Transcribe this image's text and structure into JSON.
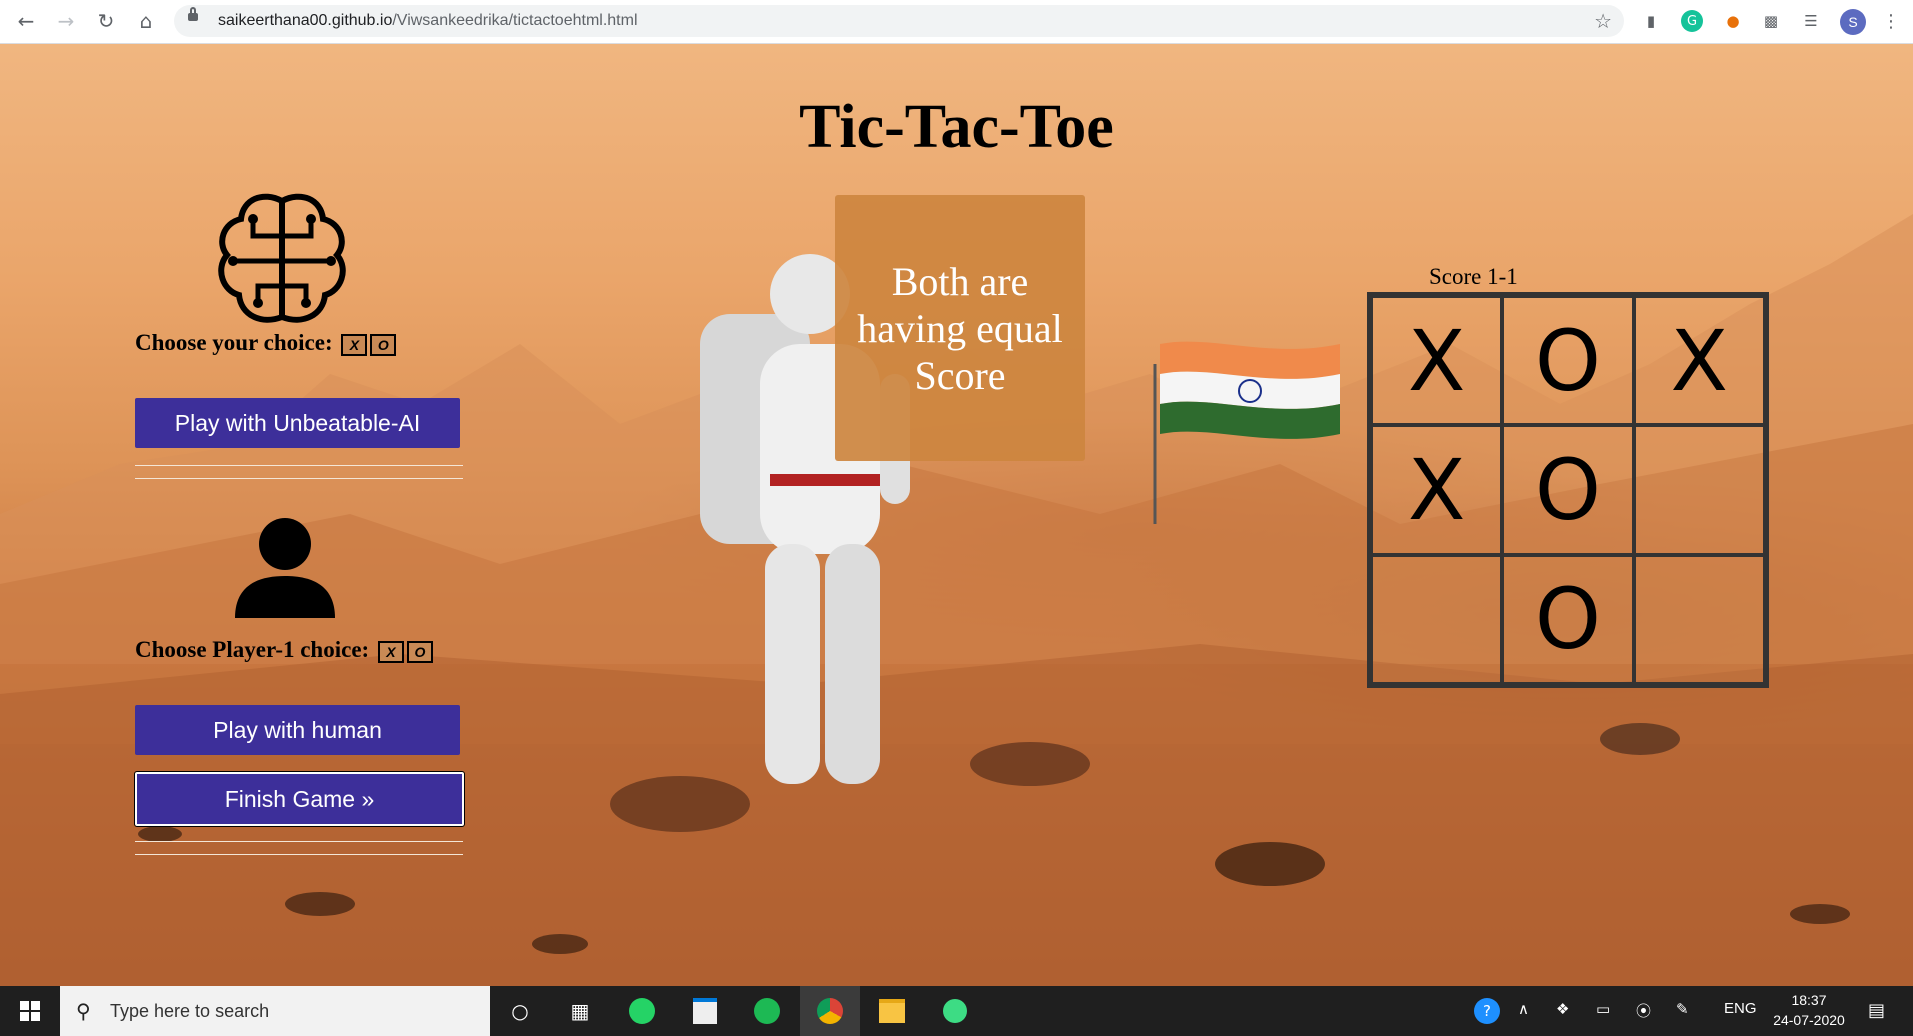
{
  "browser": {
    "url_host": "saikeerthana00.github.io",
    "url_path": "/Viwsankeedrika/tictactoehtml.html",
    "profile_initial": "S",
    "icons": [
      "back-icon",
      "forward-icon",
      "reload-icon",
      "home-icon",
      "lock-icon",
      "bookmark-star-icon",
      "extension-chart-icon",
      "grammarly-icon",
      "extension-fire-icon",
      "extensions-puzzle-icon",
      "media-queue-icon",
      "menu-dots-icon"
    ]
  },
  "game": {
    "title": "Tic-Tac-Toe",
    "ai_choice_label": "Choose your choice:",
    "player_choice_label": "Choose Player-1 choice:",
    "mark_x": "X",
    "mark_o": "O",
    "ai_button": "Play with Unbeatable-AI",
    "human_button": "Play with human",
    "finish_button": "Finish Game   »",
    "status": "Both are having equal Score",
    "score": "Score 1-1",
    "board": [
      "X",
      "O",
      "X",
      "X",
      "O",
      "",
      "",
      "O",
      ""
    ]
  },
  "taskbar": {
    "search_placeholder": "Type here to search",
    "time": "18:37",
    "date": "24-07-2020",
    "language": "ENG",
    "apps": [
      "cortana-icon",
      "task-view-icon",
      "whatsapp-icon",
      "store-icon",
      "spotify-icon",
      "chrome-icon",
      "file-explorer-icon",
      "app-icon"
    ]
  },
  "colors": {
    "button_bg": "#3d2f9a",
    "status_bg": "#cd853f",
    "board_line": "#333333"
  }
}
